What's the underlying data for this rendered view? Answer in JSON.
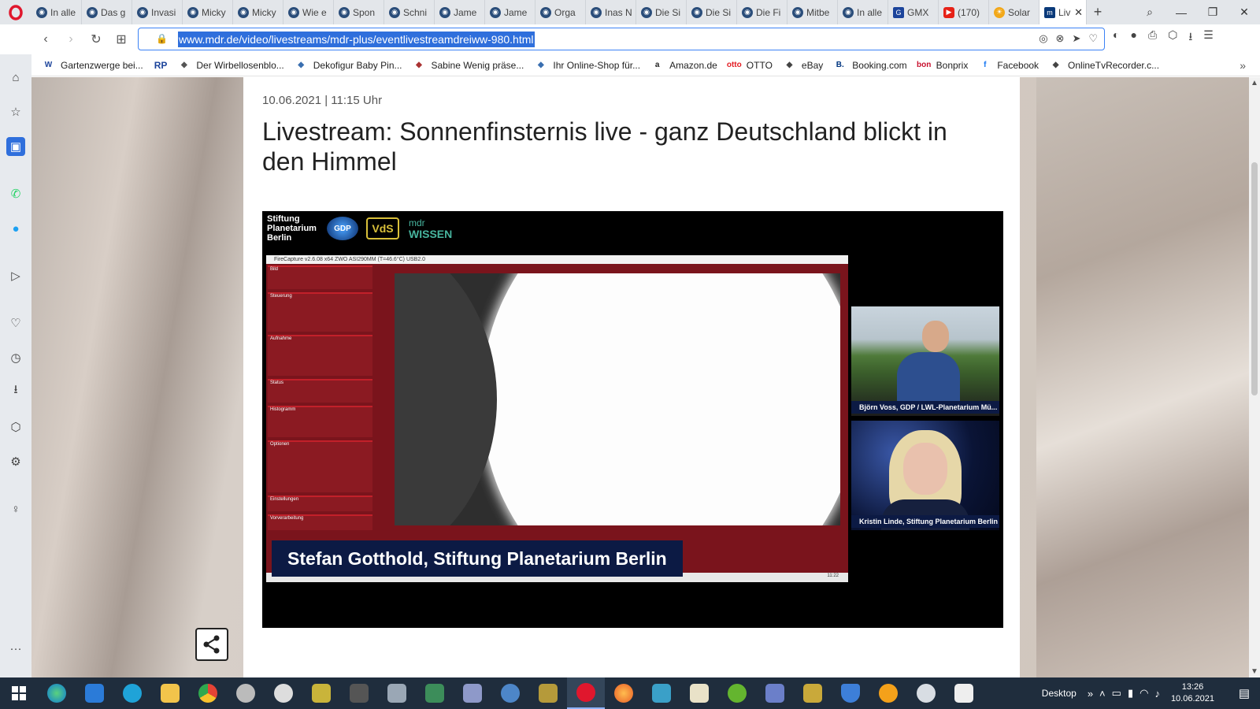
{
  "tabs": [
    {
      "label": "In alle",
      "favicon": "globe-icon"
    },
    {
      "label": "Das g",
      "favicon": "globe-icon"
    },
    {
      "label": "Invasi",
      "favicon": "globe-icon"
    },
    {
      "label": "Micky",
      "favicon": "globe-icon"
    },
    {
      "label": "Micky",
      "favicon": "globe-icon"
    },
    {
      "label": "Wie e",
      "favicon": "globe-icon"
    },
    {
      "label": "Spon",
      "favicon": "globe-icon"
    },
    {
      "label": "Schni",
      "favicon": "globe-icon"
    },
    {
      "label": "Jame",
      "favicon": "globe-icon"
    },
    {
      "label": "Jame",
      "favicon": "globe-icon"
    },
    {
      "label": "Orga",
      "favicon": "globe-icon"
    },
    {
      "label": "Inas N",
      "favicon": "globe-icon"
    },
    {
      "label": "Die Si",
      "favicon": "globe-icon"
    },
    {
      "label": "Die Si",
      "favicon": "globe-icon"
    },
    {
      "label": "Die Fi",
      "favicon": "globe-icon"
    },
    {
      "label": "Mitbe",
      "favicon": "globe-icon"
    },
    {
      "label": "In alle",
      "favicon": "globe-icon"
    },
    {
      "label": "GMX",
      "favicon": "gmx-icon"
    },
    {
      "label": "(170)",
      "favicon": "youtube-icon"
    },
    {
      "label": "Solar",
      "favicon": "solar-icon"
    },
    {
      "label": "Liv",
      "favicon": "mdr-icon",
      "active": true
    }
  ],
  "address": {
    "url": "www.mdr.de/video/livestreams/mdr-plus/eventlivestreamdreiww-980.html"
  },
  "bookmarks": [
    {
      "label": "Gartenzwerge bei...",
      "icon": "W"
    },
    {
      "label": "RP",
      "icon": ""
    },
    {
      "label": "Der Wirbellosenblo...",
      "icon": ""
    },
    {
      "label": "Dekofigur Baby Pin...",
      "icon": ""
    },
    {
      "label": "Sabine Wenig präse...",
      "icon": ""
    },
    {
      "label": "Ihr Online-Shop für...",
      "icon": ""
    },
    {
      "label": "Amazon.de",
      "icon": "a"
    },
    {
      "label": "OTTO",
      "icon": "otto"
    },
    {
      "label": "eBay",
      "icon": ""
    },
    {
      "label": "Booking.com",
      "icon": "B."
    },
    {
      "label": "Bonprix",
      "icon": "bon"
    },
    {
      "label": "Facebook",
      "icon": "f"
    },
    {
      "label": "OnlineTvRecorder.c...",
      "icon": ""
    }
  ],
  "article": {
    "date": "10.06.2021 | 11:15 Uhr",
    "title": "Livestream: Sonnenfinsternis live - ganz Deutschland blickt in den Himmel"
  },
  "video": {
    "logo_line1": "Stiftung",
    "logo_line2": "Planetarium",
    "logo_line3": "Berlin",
    "gdp_label": "GDP",
    "vds_label": "VdS",
    "mdr_label": "mdr",
    "wissen_label": "WISSEN",
    "capture_title": "FireCapture v2.6.08   x64   ZWO ASI290MM (T=46.6°C) USB2.0",
    "panel_sections": [
      "Bild",
      "Steuerung",
      "Aufnahme",
      "Status",
      "Histogramm",
      "Optionen",
      "Einstellungen",
      "Vorverarbeitung"
    ],
    "lower_third": "Stefan Gotthold, Stiftung Planetarium Berlin",
    "cam1_label": "Björn Voss, GDP / LWL-Planetarium Mü...",
    "cam2_label": "Kristin Linde, Stiftung Planetarium Berlin",
    "capture_clock": "11:22"
  },
  "taskbar": {
    "desktop_label": "Desktop",
    "time": "13:26",
    "date": "10.06.2021"
  },
  "colors": {
    "accent": "#2f6fdc",
    "video_bg": "#000000",
    "capture_red": "#7a141c",
    "lower_third_bg": "#0c1a44",
    "taskbar_bg": "#1f2d3d"
  }
}
